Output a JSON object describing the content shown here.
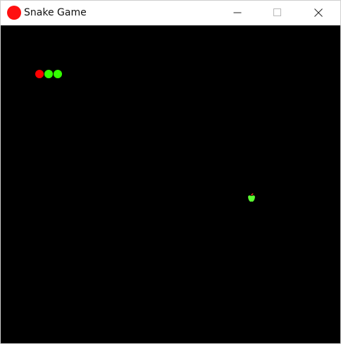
{
  "window": {
    "title": "Snake Game",
    "icon": "red-circle-icon",
    "controls": [
      "minimize-icon",
      "maximize-icon",
      "close-icon"
    ]
  },
  "game": {
    "snake": {
      "head_color": "#ff0000",
      "body_color": "#33ff00",
      "segments": 3
    },
    "apple": {
      "icon": "apple-icon",
      "color": "#5cff33"
    },
    "background": "#000000"
  }
}
